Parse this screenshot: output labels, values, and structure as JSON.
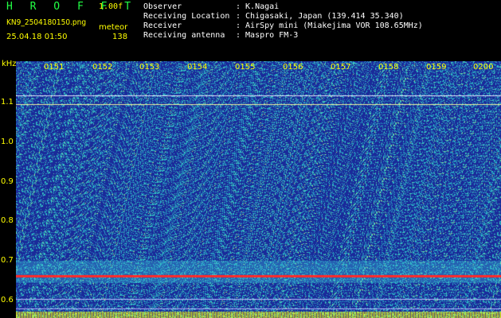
{
  "header": {
    "brand": "H R O F F T",
    "version": "1.00f",
    "filename": "KN9_2504180150.png",
    "mode": "meteor",
    "datetime": "25.04.18 01:50",
    "count": "138"
  },
  "station": [
    {
      "label": "Observer",
      "value": ": K.Nagai"
    },
    {
      "label": "Receiving Location",
      "value": ": Chigasaki, Japan (139.414 35.340)"
    },
    {
      "label": "Receiver",
      "value": ": AirSpy mini (Miakejima VOR 108.65MHz)"
    },
    {
      "label": "Receiving antenna",
      "value": ": Maspro FM-3"
    }
  ],
  "spectrogram": {
    "y_unit": "kHz",
    "y_ticks": [
      "1.1",
      "1.0",
      "0.9",
      "0.8",
      "0.7",
      "0.6"
    ],
    "y_range_khz": [
      0.575,
      1.16
    ],
    "time_ticks": [
      "0151",
      "0152",
      "0153",
      "0154",
      "0155",
      "0156",
      "0157",
      "0158",
      "0159",
      "0200"
    ],
    "background_color": "#1a2a9a",
    "noise_color": "#2aa7c8",
    "carrier_color": "#ff2a2a",
    "lines": [
      {
        "freq_khz": 1.082,
        "color": "#e8e8ff"
      },
      {
        "freq_khz": 1.062,
        "color": "#f0f0a0"
      },
      {
        "freq_khz": 0.673,
        "color": "#ff2a2a"
      },
      {
        "freq_khz": 0.618,
        "color": "#b8b8ff"
      },
      {
        "freq_khz": 0.597,
        "color": "#b8b8ff"
      }
    ],
    "baseline_color": "#ffff00"
  }
}
